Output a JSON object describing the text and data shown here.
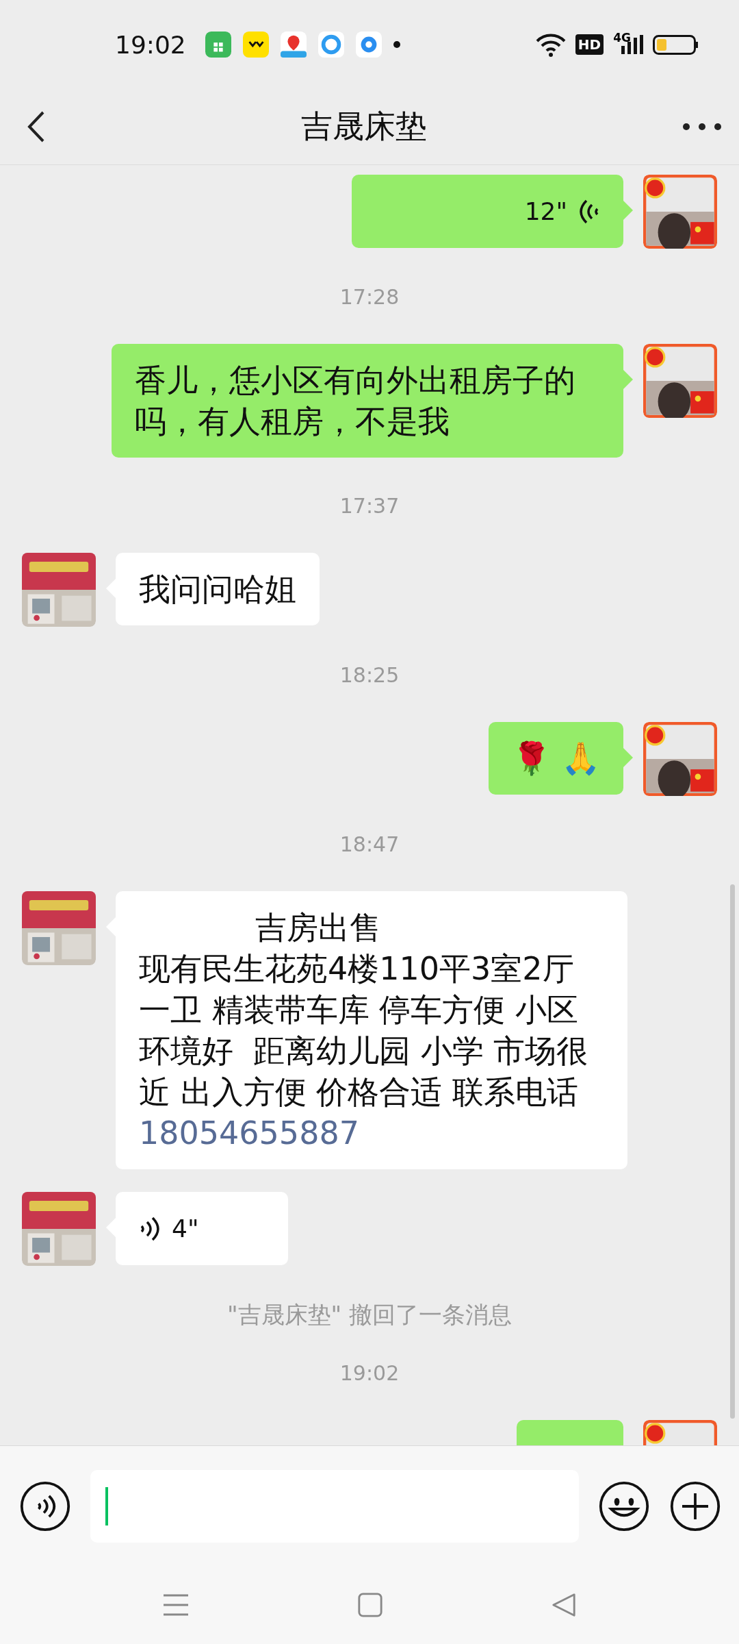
{
  "status_bar": {
    "time": "19:02",
    "hd_badge": "HD",
    "network": "4G"
  },
  "header": {
    "title": "吉晟床垫"
  },
  "messages": [
    {
      "kind": "voice",
      "outgoing": true,
      "duration": "12\""
    },
    {
      "kind": "time",
      "text": "17:28"
    },
    {
      "kind": "text",
      "outgoing": true,
      "text": "香儿，恁小区有向外出租房子的吗，有人租房，不是我"
    },
    {
      "kind": "time",
      "text": "17:37"
    },
    {
      "kind": "text",
      "outgoing": false,
      "text": "我问问哈姐"
    },
    {
      "kind": "time",
      "text": "18:25"
    },
    {
      "kind": "text",
      "outgoing": true,
      "text": "🌹 🙏"
    },
    {
      "kind": "time",
      "text": "18:47"
    },
    {
      "kind": "text",
      "outgoing": false,
      "heading": "吉房出售",
      "text": "现有民生花苑4楼110平3室2厅一卫 精装带车库 停车方便 小区环境好  距离幼儿园 小学 市场很近 出入方便 价格合适 联系电话",
      "link": "18054655887"
    },
    {
      "kind": "voice",
      "outgoing": false,
      "duration": "4\""
    },
    {
      "kind": "notice",
      "text": "\"吉晟床垫\" 撤回了一条消息"
    },
    {
      "kind": "time",
      "text": "19:02"
    },
    {
      "kind": "partial",
      "outgoing": true
    }
  ]
}
